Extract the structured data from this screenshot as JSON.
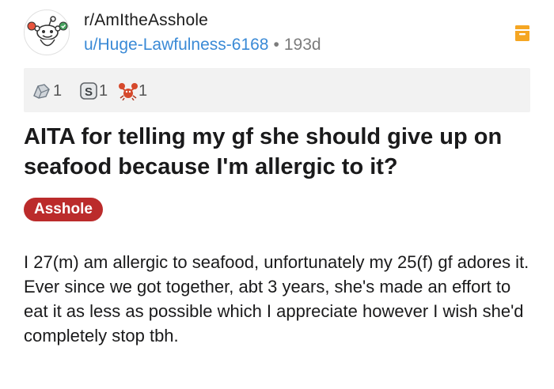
{
  "post": {
    "subreddit": "r/AmItheAsshole",
    "username": "u/Huge-Lawfulness-6168",
    "separator": "•",
    "age": "193d",
    "awards": [
      {
        "icon": "silver-award-icon",
        "count": "1"
      },
      {
        "icon": "s-coin-award-icon",
        "count": "1"
      },
      {
        "icon": "lobster-award-icon",
        "count": "1"
      }
    ],
    "title": "AITA for telling my gf she should give up on seafood because I'm allergic to it?",
    "flair": "Asshole",
    "body": "I 27(m) am allergic to seafood, unfortunately my 25(f) gf adores it. Ever since we got together, abt 3 years, she's made an effort to eat it as less as possible which I appreciate however I wish she'd completely stop tbh."
  },
  "colors": {
    "link": "#3a8ad6",
    "flair_bg": "#bb2b2b",
    "save_icon": "#f5a623",
    "awards_bg": "#f2f2f2"
  }
}
